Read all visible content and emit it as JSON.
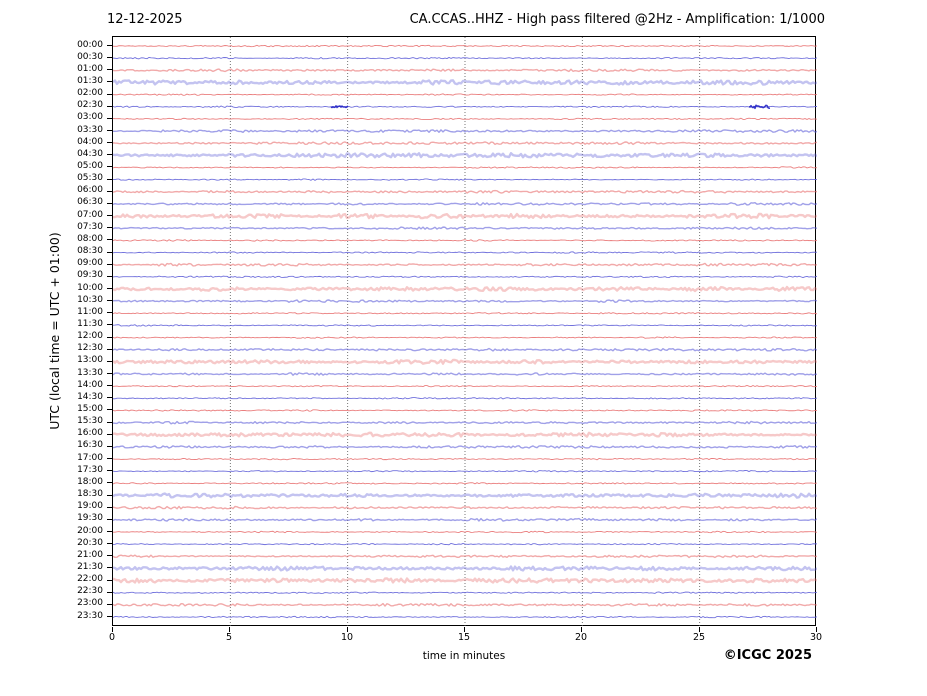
{
  "header": {
    "date": "12-12-2025",
    "title": "CA.CCAS..HHZ - High pass filtered @2Hz - Amplification: 1/1000"
  },
  "footer": {
    "copyright": "©ICGC 2025"
  },
  "chart_data": {
    "type": "line",
    "subtype": "helicorder-seismogram",
    "title": "CA.CCAS..HHZ - High pass filtered @2Hz - Amplification: 1/1000",
    "date": "12-12-2025",
    "xlabel": "time in minutes",
    "ylabel": "UTC (local time = UTC + 01:00)",
    "xlim": [
      0,
      30
    ],
    "x_ticks": [
      0,
      5,
      10,
      15,
      20,
      25,
      30
    ],
    "grid": "vertical dotted lines at 5,10,15,20,25 minutes",
    "legend_position": "none",
    "row_minutes_span": 30,
    "noise_legend": {
      "1": "thin crisp trace",
      "2": "slightly fuzzy trace",
      "3": "wide faint fuzzy trace"
    },
    "palette": {
      "red": "#e87070",
      "blue": "#6060d8",
      "event_blue": "#2424c4",
      "event_red": "#c42424",
      "grid": "#555555",
      "axis": "#000000"
    },
    "rows": [
      {
        "label": "00:00",
        "color": "red",
        "noise": 1
      },
      {
        "label": "00:30",
        "color": "blue",
        "noise": 1
      },
      {
        "label": "01:00",
        "color": "red",
        "noise": 2
      },
      {
        "label": "01:30",
        "color": "blue",
        "noise": 3
      },
      {
        "label": "02:00",
        "color": "red",
        "noise": 1
      },
      {
        "label": "02:30",
        "color": "blue",
        "noise": 1,
        "events": [
          {
            "start_min": 9.3,
            "end_min": 10.0,
            "amp": 0.9
          },
          {
            "start_min": 27.1,
            "end_min": 28.0,
            "amp": 1.7
          }
        ]
      },
      {
        "label": "03:00",
        "color": "red",
        "noise": 1
      },
      {
        "label": "03:30",
        "color": "blue",
        "noise": 2
      },
      {
        "label": "04:00",
        "color": "red",
        "noise": 2
      },
      {
        "label": "04:30",
        "color": "blue",
        "noise": 3
      },
      {
        "label": "05:00",
        "color": "red",
        "noise": 1
      },
      {
        "label": "05:30",
        "color": "blue",
        "noise": 1
      },
      {
        "label": "06:00",
        "color": "red",
        "noise": 2
      },
      {
        "label": "06:30",
        "color": "blue",
        "noise": 2
      },
      {
        "label": "07:00",
        "color": "red",
        "noise": 3
      },
      {
        "label": "07:30",
        "color": "blue",
        "noise": 2
      },
      {
        "label": "08:00",
        "color": "red",
        "noise": 1
      },
      {
        "label": "08:30",
        "color": "blue",
        "noise": 1
      },
      {
        "label": "09:00",
        "color": "red",
        "noise": 2
      },
      {
        "label": "09:30",
        "color": "blue",
        "noise": 1
      },
      {
        "label": "10:00",
        "color": "red",
        "noise": 3
      },
      {
        "label": "10:30",
        "color": "blue",
        "noise": 2
      },
      {
        "label": "11:00",
        "color": "red",
        "noise": 1
      },
      {
        "label": "11:30",
        "color": "blue",
        "noise": 1
      },
      {
        "label": "12:00",
        "color": "red",
        "noise": 1
      },
      {
        "label": "12:30",
        "color": "blue",
        "noise": 2
      },
      {
        "label": "13:00",
        "color": "red",
        "noise": 3
      },
      {
        "label": "13:30",
        "color": "blue",
        "noise": 2
      },
      {
        "label": "14:00",
        "color": "red",
        "noise": 1
      },
      {
        "label": "14:30",
        "color": "blue",
        "noise": 1
      },
      {
        "label": "15:00",
        "color": "red",
        "noise": 1
      },
      {
        "label": "15:30",
        "color": "blue",
        "noise": 2
      },
      {
        "label": "16:00",
        "color": "red",
        "noise": 3
      },
      {
        "label": "16:30",
        "color": "blue",
        "noise": 2
      },
      {
        "label": "17:00",
        "color": "red",
        "noise": 1
      },
      {
        "label": "17:30",
        "color": "blue",
        "noise": 1
      },
      {
        "label": "18:00",
        "color": "red",
        "noise": 1
      },
      {
        "label": "18:30",
        "color": "blue",
        "noise": 3
      },
      {
        "label": "19:00",
        "color": "red",
        "noise": 2
      },
      {
        "label": "19:30",
        "color": "blue",
        "noise": 2
      },
      {
        "label": "20:00",
        "color": "red",
        "noise": 1
      },
      {
        "label": "20:30",
        "color": "blue",
        "noise": 1
      },
      {
        "label": "21:00",
        "color": "red",
        "noise": 2
      },
      {
        "label": "21:30",
        "color": "blue",
        "noise": 3
      },
      {
        "label": "22:00",
        "color": "red",
        "noise": 3
      },
      {
        "label": "22:30",
        "color": "blue",
        "noise": 1
      },
      {
        "label": "23:00",
        "color": "red",
        "noise": 2
      },
      {
        "label": "23:30",
        "color": "blue",
        "noise": 1
      }
    ]
  }
}
